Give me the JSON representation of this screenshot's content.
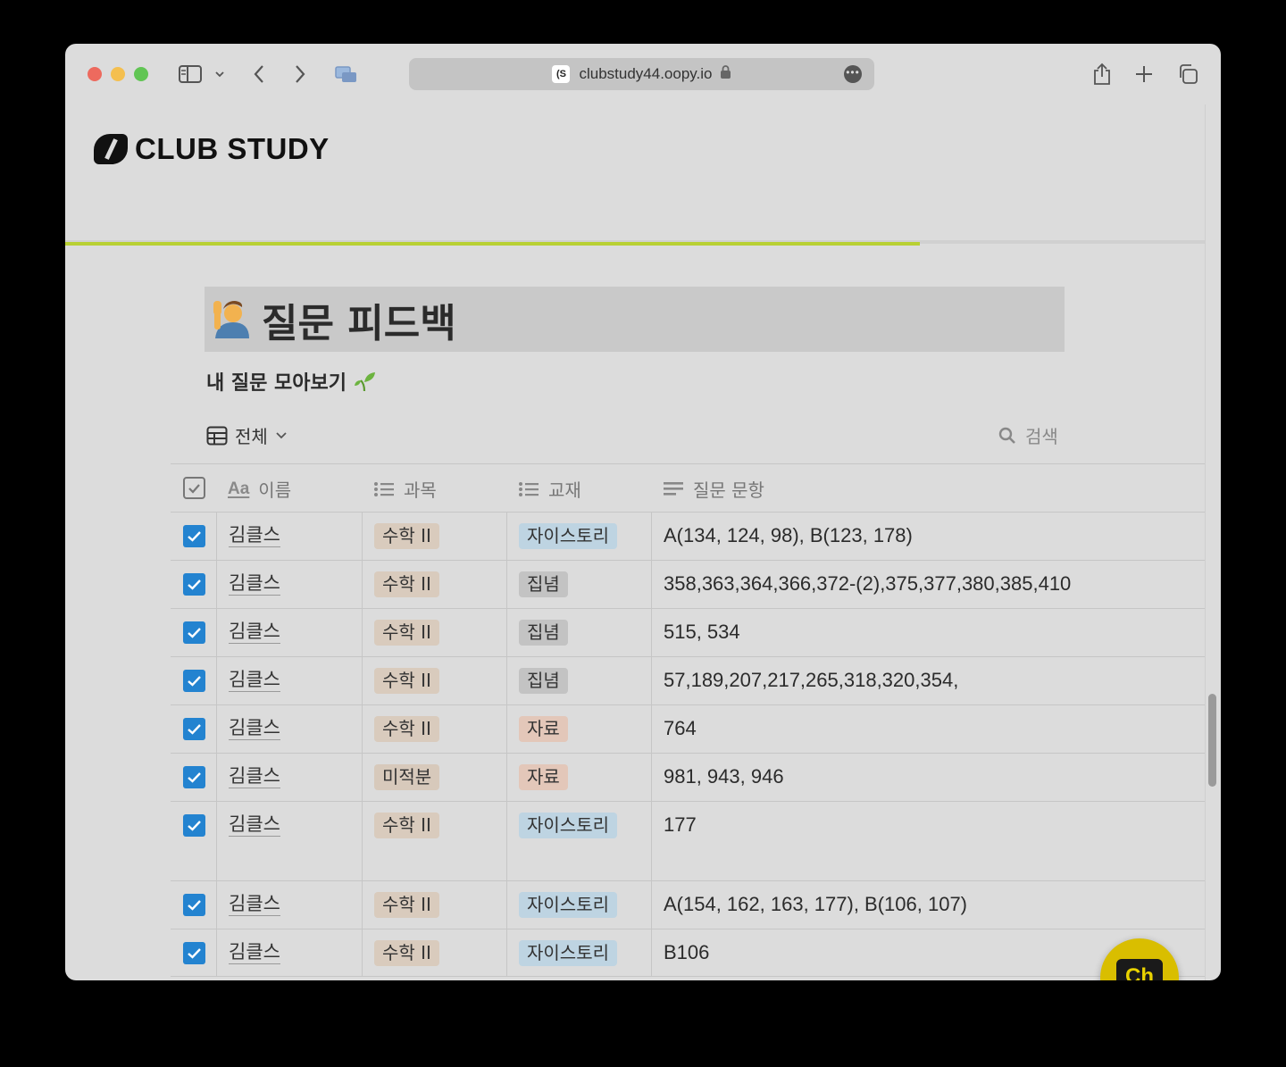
{
  "browser": {
    "url": "clubstudy44.oopy.io"
  },
  "site": {
    "logo_text": "CLUB STUDY"
  },
  "page": {
    "title": "질문 피드백",
    "subtitle": "내 질문 모아보기",
    "view_label": "전체",
    "search_placeholder": "검색"
  },
  "reading_progress": 0.75,
  "table": {
    "headers": {
      "name": "이름",
      "name_icon": "Aa",
      "subject": "과목",
      "textbook": "교재",
      "question": "질문 문항"
    },
    "rows": [
      {
        "name": "김클스",
        "subject": "수학 II",
        "textbook": "자이스토리",
        "question": "A(134, 124, 98), B(123, 178)"
      },
      {
        "name": "김클스",
        "subject": "수학 II",
        "textbook": "집념",
        "question": "358,363,364,366,372-(2),375,377,380,385,410"
      },
      {
        "name": "김클스",
        "subject": "수학 II",
        "textbook": "집념",
        "question": "515, 534"
      },
      {
        "name": "김클스",
        "subject": "수학 II",
        "textbook": "집념",
        "question": "57,189,207,217,265,318,320,354,"
      },
      {
        "name": "김클스",
        "subject": "수학 II",
        "textbook": "자료",
        "question": "764"
      },
      {
        "name": "김클스",
        "subject": "미적분",
        "textbook": "자료",
        "question": "981, 943, 946"
      },
      {
        "name": "김클스",
        "subject": "수학 II",
        "textbook": "자이스토리",
        "question": "177"
      },
      {
        "name": "김클스",
        "subject": "수학 II",
        "textbook": "자이스토리",
        "question": "A(154, 162, 163, 177), B(106, 107)"
      },
      {
        "name": "김클스",
        "subject": "수학 II",
        "textbook": "자이스토리",
        "question": "B106"
      }
    ]
  },
  "chat": {
    "label": "Ch"
  }
}
